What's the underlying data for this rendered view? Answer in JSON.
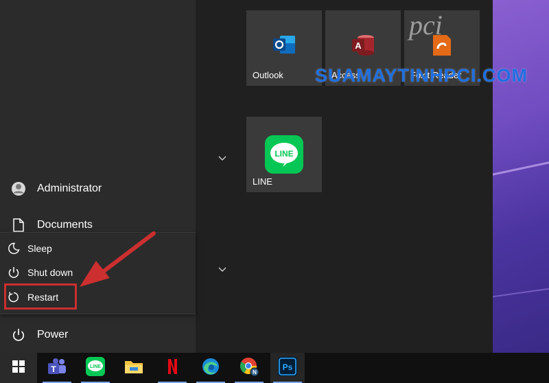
{
  "start_menu": {
    "user": {
      "name": "Administrator",
      "icon": "user-icon"
    },
    "documents": {
      "label": "Documents",
      "icon": "document-icon"
    },
    "power": {
      "label": "Power",
      "icon": "power-icon"
    },
    "power_options": [
      {
        "label": "Sleep",
        "icon": "moon-icon"
      },
      {
        "label": "Shut down",
        "icon": "power-icon"
      },
      {
        "label": "Restart",
        "icon": "restart-icon"
      }
    ]
  },
  "tiles": [
    {
      "label": "Outlook",
      "icon": "outlook-icon",
      "color": "#0f6cbd"
    },
    {
      "label": "Access",
      "icon": "access-icon",
      "color": "#a4262c"
    },
    {
      "label": "Foxit Reader",
      "icon": "foxit-icon",
      "color": "#e46a17"
    },
    {
      "label": "LINE",
      "icon": "line-icon",
      "color": "#06c755"
    }
  ],
  "watermark": {
    "text": "SUAMAYTINH",
    "suffix": "PCI.COM",
    "logo": "pci"
  },
  "taskbar": {
    "items": [
      {
        "name": "windows-start-icon"
      },
      {
        "name": "teams-icon",
        "color": "#5b5fc7"
      },
      {
        "name": "line-icon",
        "text": "LINE",
        "color": "#06c755"
      },
      {
        "name": "file-explorer-icon",
        "color": "#f4c542"
      },
      {
        "name": "netflix-icon",
        "text": "N",
        "color": "#e50914"
      },
      {
        "name": "edge-icon",
        "color": "#1a8bd8"
      },
      {
        "name": "chrome-icon",
        "badge": "N",
        "color": "#e34133"
      },
      {
        "name": "photoshop-icon",
        "text": "Ps",
        "color": "#31a8ff"
      }
    ]
  },
  "colors": {
    "accent_arrow": "#cc2f2f",
    "tile_bg": "#3a3a3a"
  }
}
